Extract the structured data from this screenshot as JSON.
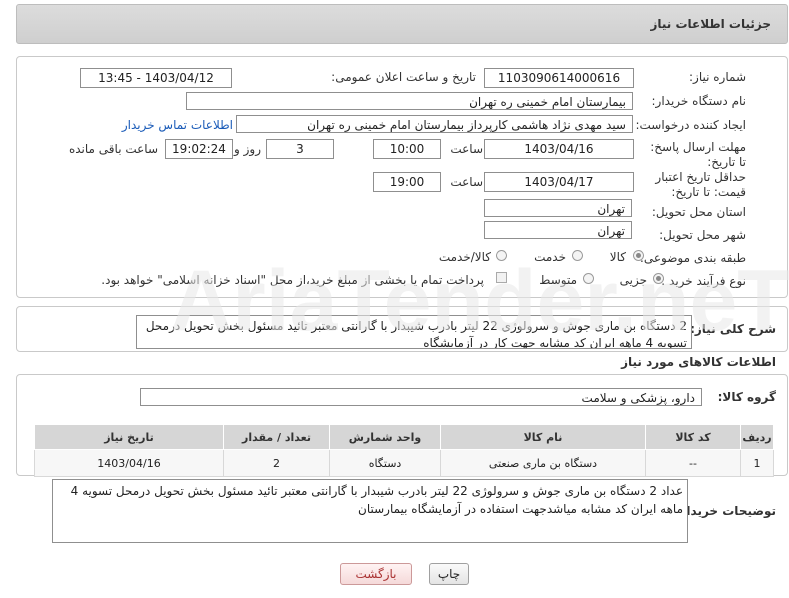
{
  "header": {
    "title": "جزئیات اطلاعات نیاز"
  },
  "fields": {
    "need_number_label": "شماره نیاز:",
    "need_number": "1103090614000616",
    "announce_datetime_label": "تاریخ و ساعت اعلان عمومی:",
    "announce_datetime": "1403/04/12 - 13:45",
    "buyer_org_label": "نام دستگاه خریدار:",
    "buyer_org": "بیمارستان امام خمینی ره  تهران",
    "creator_label": "ایجاد کننده درخواست:",
    "creator": "سید مهدی  نژاد هاشمی  کارپرداز بیمارستان امام خمینی ره  تهران",
    "contact_link": "اطلاعات تماس خریدار",
    "deadline_label": "مهلت ارسال پاسخ: تا تاریخ:",
    "deadline_date": "1403/04/16",
    "time_label": "ساعت",
    "deadline_time": "10:00",
    "days_value": "3",
    "days_label": "روز و",
    "remaining_time": "19:02:24",
    "remaining_label": "ساعت باقی مانده",
    "validity_label": "حداقل تاریخ اعتبار قیمت: تا تاریخ:",
    "validity_date": "1403/04/17",
    "validity_time_label": "ساعت",
    "validity_time": "19:00",
    "province_label": "استان محل تحویل:",
    "province": "تهران",
    "city_label": "شهر محل تحویل:",
    "city": "تهران",
    "category_label": "طبقه بندی موضوعی:",
    "category_options": [
      "کالا",
      "خدمت",
      "کالا/خدمت"
    ],
    "purchase_type_label": "نوع فرآیند خرید :",
    "purchase_options": [
      "جزیی",
      "متوسط"
    ],
    "payment_note": "پرداخت تمام یا بخشی از مبلغ خرید،از محل \"اسناد خزانه اسلامی\" خواهد بود."
  },
  "summary": {
    "label": "شرح کلی نیاز:",
    "text": "2 دستگاه بن ماری جوش  و سرولوژی 22 لیتر بادرب شیبدار با گارانتی معتبر تائید مسئول بخش تحویل درمحل  تسویه 4 ماهه ایران کد مشابه جهت کار در آزمایشگاه"
  },
  "goods_info_title": "اطلاعات کالاهای مورد نیاز",
  "goods_group": {
    "label": "گروه کالا:",
    "value": "دارو، پزشکی و سلامت"
  },
  "table": {
    "headers": [
      "ردیف",
      "کد کالا",
      "نام کالا",
      "واحد شمارش",
      "تعداد / مقدار",
      "تاریخ نیاز"
    ],
    "rows": [
      [
        "1",
        "--",
        "دستگاه بن ماری صنعتی",
        "دستگاه",
        "2",
        "1403/04/16"
      ]
    ]
  },
  "buyer_notes": {
    "label": "توضیحات خریدار:",
    "text": "عداد 2 دستگاه بن ماری  جوش و سرولوژی 22 لیتر بادرب شیبدار با گارانتی معتبر تائید مسئول بخش تحویل درمحل  تسویه 4 ماهه ایران کد مشابه میاشدجهت استفاده در آزمایشگاه بیمارستان"
  },
  "buttons": {
    "print": "چاپ",
    "back": "بازگشت"
  },
  "watermark": "AriaTender.neT"
}
